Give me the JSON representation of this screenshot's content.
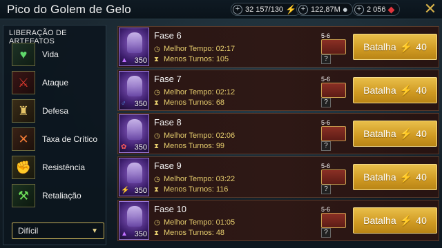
{
  "header": {
    "title": "Pico do Golem de Gelo",
    "energy": "32 157/130",
    "silver": "122,87M",
    "gems": "2 056"
  },
  "sidebar": {
    "title": "LIBERAÇÃO DE ARTEFATOS",
    "items": [
      {
        "label": "Vida",
        "icon": "heart-icon"
      },
      {
        "label": "Ataque",
        "icon": "sword-icon"
      },
      {
        "label": "Defesa",
        "icon": "tower-icon"
      },
      {
        "label": "Taxa de Crítico",
        "icon": "crossed-swords-icon"
      },
      {
        "label": "Resistência",
        "icon": "fist-icon"
      },
      {
        "label": "Retaliação",
        "icon": "scythe-icon"
      }
    ],
    "difficulty": "Difícil"
  },
  "stages": [
    {
      "name": "Fase 6",
      "best_time": "Melhor Tempo: 02:17",
      "min_turns": "Menos Turnos: 105",
      "level": "350",
      "reward_range": "5-6",
      "battle": "Batalha",
      "cost": "40"
    },
    {
      "name": "Fase 7",
      "best_time": "Melhor Tempo: 02:12",
      "min_turns": "Menos Turnos: 68",
      "level": "350",
      "reward_range": "5-6",
      "battle": "Batalha",
      "cost": "40"
    },
    {
      "name": "Fase 8",
      "best_time": "Melhor Tempo: 02:06",
      "min_turns": "Menos Turnos: 99",
      "level": "350",
      "reward_range": "5-6",
      "battle": "Batalha",
      "cost": "40"
    },
    {
      "name": "Fase 9",
      "best_time": "Melhor Tempo: 03:22",
      "min_turns": "Menos Turnos: 116",
      "level": "350",
      "reward_range": "5-6",
      "battle": "Batalha",
      "cost": "40"
    },
    {
      "name": "Fase 10",
      "best_time": "Melhor Tempo: 01:05",
      "min_turns": "Menos Turnos: 48",
      "level": "350",
      "reward_range": "5-6",
      "battle": "Batalha",
      "cost": "40"
    }
  ],
  "colors": {
    "accent_gold": "#e9bf4a",
    "time_text": "#e8cf6e",
    "row_bg": "#2a1614"
  }
}
